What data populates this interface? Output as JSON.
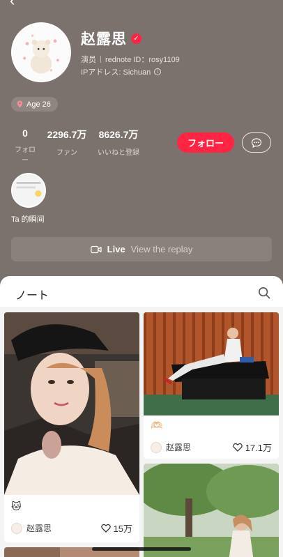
{
  "profile": {
    "name": "赵露思",
    "role": "演员",
    "redbook_id": "rednote ID：rosy1109",
    "ip_location": "IPアドレス: Sichuan",
    "age_tag": "Age 26"
  },
  "stats": [
    {
      "value": "0",
      "label": "フォロー"
    },
    {
      "value": "2296.7万",
      "label": "ファン"
    },
    {
      "value": "8626.7万",
      "label": "いいねと登録"
    }
  ],
  "actions": {
    "follow_label": "フォロー"
  },
  "story": {
    "label": "Ta 的瞬间"
  },
  "live": {
    "label": "Live",
    "sub": "View the replay"
  },
  "notes": {
    "tab_title": "ノート",
    "cards": [
      {
        "title": "🐱",
        "author": "赵露思",
        "likes": "15万"
      },
      {
        "title": "🫶🏻",
        "author": "赵露思",
        "likes": "17.1万"
      }
    ]
  },
  "colors": {
    "accent": "#ff2442",
    "header_bg": "#7c726d"
  },
  "icons": {
    "back": "chevron-left-icon",
    "verified": "verified-badge-icon",
    "location": "location-pin-icon",
    "info": "info-icon",
    "message": "message-bubble-icon",
    "live": "video-camera-icon",
    "search": "search-icon",
    "heart": "heart-icon"
  }
}
